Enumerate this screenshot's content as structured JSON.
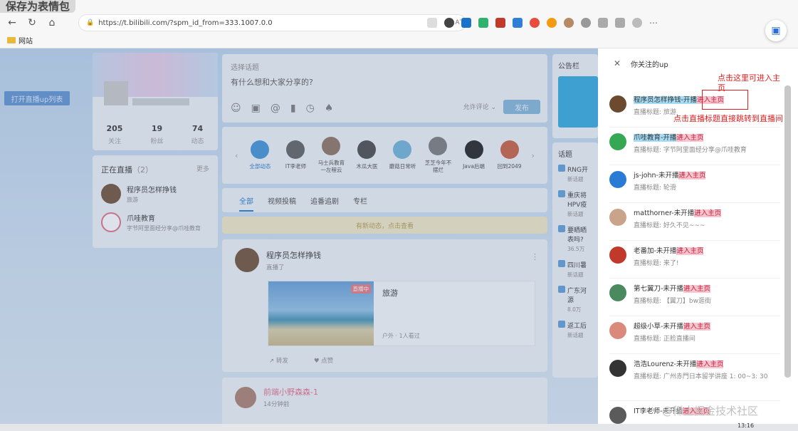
{
  "overlay_title": "保存为表情包",
  "browser": {
    "url": "https://t.bilibili.com/?spm_id_from=333.1007.0.0",
    "read_aloud": "Aʹ",
    "bookmark_folder": "网站"
  },
  "left": {
    "open_live_button": "打开直播up列表",
    "stats": [
      {
        "num": "205",
        "label": "关注"
      },
      {
        "num": "19",
        "label": "粉丝"
      },
      {
        "num": "74",
        "label": "动态"
      }
    ],
    "living": {
      "title": "正在直播",
      "count": "（2）",
      "more": "更多",
      "items": [
        {
          "name": "程序员怎样挣钱",
          "sub": "旅游",
          "color": "#6b4a2f"
        },
        {
          "name": "爪哇教育",
          "sub": "字节阿里面经分享@爪哇教育",
          "color": "#35a853"
        }
      ]
    }
  },
  "publish": {
    "topic": "选择话题",
    "prompt": "有什么想和大家分享的?",
    "comment_select": "允许评论",
    "send": "发布"
  },
  "follow_strip": [
    {
      "name": "全部动态",
      "color": "#3a8fd6",
      "active": true
    },
    {
      "name": "IT李老师",
      "color": "#5b5b5b",
      "active": false
    },
    {
      "name": "马士兵教育一左程云",
      "color": "#8a6e5a",
      "active": false
    },
    {
      "name": "木瓜大医",
      "color": "#444444",
      "active": false
    },
    {
      "name": "蘑菇日常听",
      "color": "#6bb0d6",
      "active": false
    },
    {
      "name": "芝芝今年不摆烂",
      "color": "#777777",
      "active": false
    },
    {
      "name": "Java后端",
      "color": "#1a1a1a",
      "active": false
    },
    {
      "name": "回到2049",
      "color": "#c85a3a",
      "active": false
    }
  ],
  "tabs": [
    "全部",
    "视频投稿",
    "追番追剧",
    "专栏"
  ],
  "new_post_tip": "有新动态，点击查看",
  "post": {
    "name": "程序员怎样挣钱",
    "sub": "直播了",
    "live_badge": "直播中",
    "live_title": "旅游",
    "meta": "户外 · 1人看过",
    "forward": "转发",
    "like": "点赞"
  },
  "post2": {
    "name": "前端小野森森-1",
    "sub": "14分钟前"
  },
  "sidebar": {
    "board_title": "公告栏",
    "topics_title": "话题",
    "topics": [
      {
        "title": "RNG开",
        "sub": "新话题"
      },
      {
        "title": "重庆将HPV疫",
        "sub": "新话题"
      },
      {
        "title": "要晒晒表吗?",
        "sub": "36.5万"
      },
      {
        "title": "四川暑",
        "sub": "新话题"
      },
      {
        "title": "广东河源",
        "sub": "8.0万"
      },
      {
        "title": "返工后",
        "sub": "新话题"
      }
    ]
  },
  "panel": {
    "title": "你关注的up",
    "items": [
      {
        "name": "程序员怎样挣钱-开播",
        "link": "进入主页",
        "live": true,
        "sub": "直播标题: 旅游",
        "color": "#6b4a2f"
      },
      {
        "name": "爪哇教育-开播",
        "link": "进入主页",
        "live": true,
        "sub": "直播标题: 字节阿里面经分享@爪哇教育",
        "color": "#35a853"
      },
      {
        "name": "js-john-未开播",
        "link": "进入主页",
        "live": false,
        "sub": "直播标题: 轮滑",
        "color": "#2a7bd6"
      },
      {
        "name": "matthorner-未开播",
        "link": "进入主页",
        "live": false,
        "sub": "直播标题: 好久不见~~~",
        "color": "#c9a48a"
      },
      {
        "name": "老番加-未开播",
        "link": "进入主页",
        "live": false,
        "sub": "直播标题: 来了!",
        "color": "#c0392b"
      },
      {
        "name": "第七翼刀-未开播",
        "link": "进入主页",
        "live": false,
        "sub": "直播标题: 【翼刀】bw逛街",
        "color": "#4a8a5e"
      },
      {
        "name": "超级小草-未开播",
        "link": "进入主页",
        "live": false,
        "sub": "直播标题: 正脸直播间",
        "color": "#d98a7a"
      },
      {
        "name": "浩浩Lourenz-未开播",
        "link": "进入主页",
        "live": false,
        "sub": "直播标题: 广州赤門日本留学讲座 1: 00~3: 30",
        "color": "#333333"
      },
      {
        "name": "IT李老师-未开播",
        "link": "进入主页",
        "live": false,
        "sub": "",
        "color": "#5b5b5b"
      }
    ]
  },
  "annotations": {
    "note1": "点击这里可进入主页",
    "note2": "点击直播标题直接跳转到直播间"
  },
  "watermark": "@稀土掘金技术社区",
  "taskbar_time": "13:16"
}
